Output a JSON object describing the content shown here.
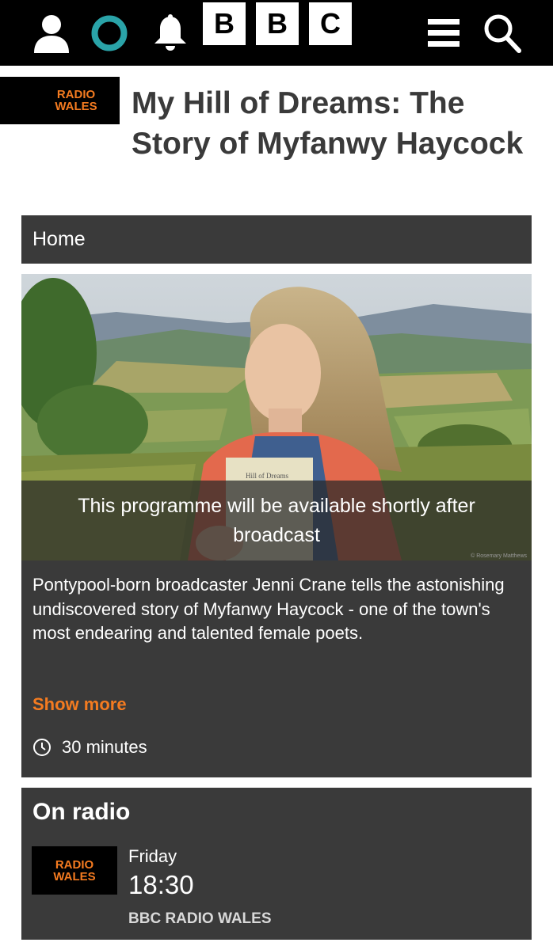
{
  "nav": {
    "icons": [
      "account-icon",
      "sounds-icon",
      "notifications-icon",
      "menu-icon",
      "search-icon"
    ],
    "brand": [
      "B",
      "B",
      "C"
    ]
  },
  "header": {
    "station_logo": [
      "RADIO",
      "WALES"
    ],
    "title": "My Hill of Dreams: The Story of Myfanwy Haycock"
  },
  "breadcrumb": {
    "label": "Home"
  },
  "programme": {
    "availability": "This programme will be available shortly after broadcast",
    "image_credit": "© Rosemary Matthews",
    "description": "Pontypool-born broadcaster Jenni Crane tells the astonishing undiscovered story of Myfanwy Haycock - one of the town's most endearing and talented female poets.",
    "show_more": "Show more",
    "duration": "30 minutes",
    "book_title": "Hill of Dreams"
  },
  "on_radio": {
    "heading": "On radio",
    "station_logo": [
      "RADIO",
      "WALES"
    ],
    "day": "Friday",
    "time": "18:30",
    "station": "BBC RADIO WALES"
  },
  "colors": {
    "accent": "#f47b20",
    "panel": "#3a3a3a",
    "topbar": "#000000",
    "sounds_ring": "#2aa3a8"
  }
}
